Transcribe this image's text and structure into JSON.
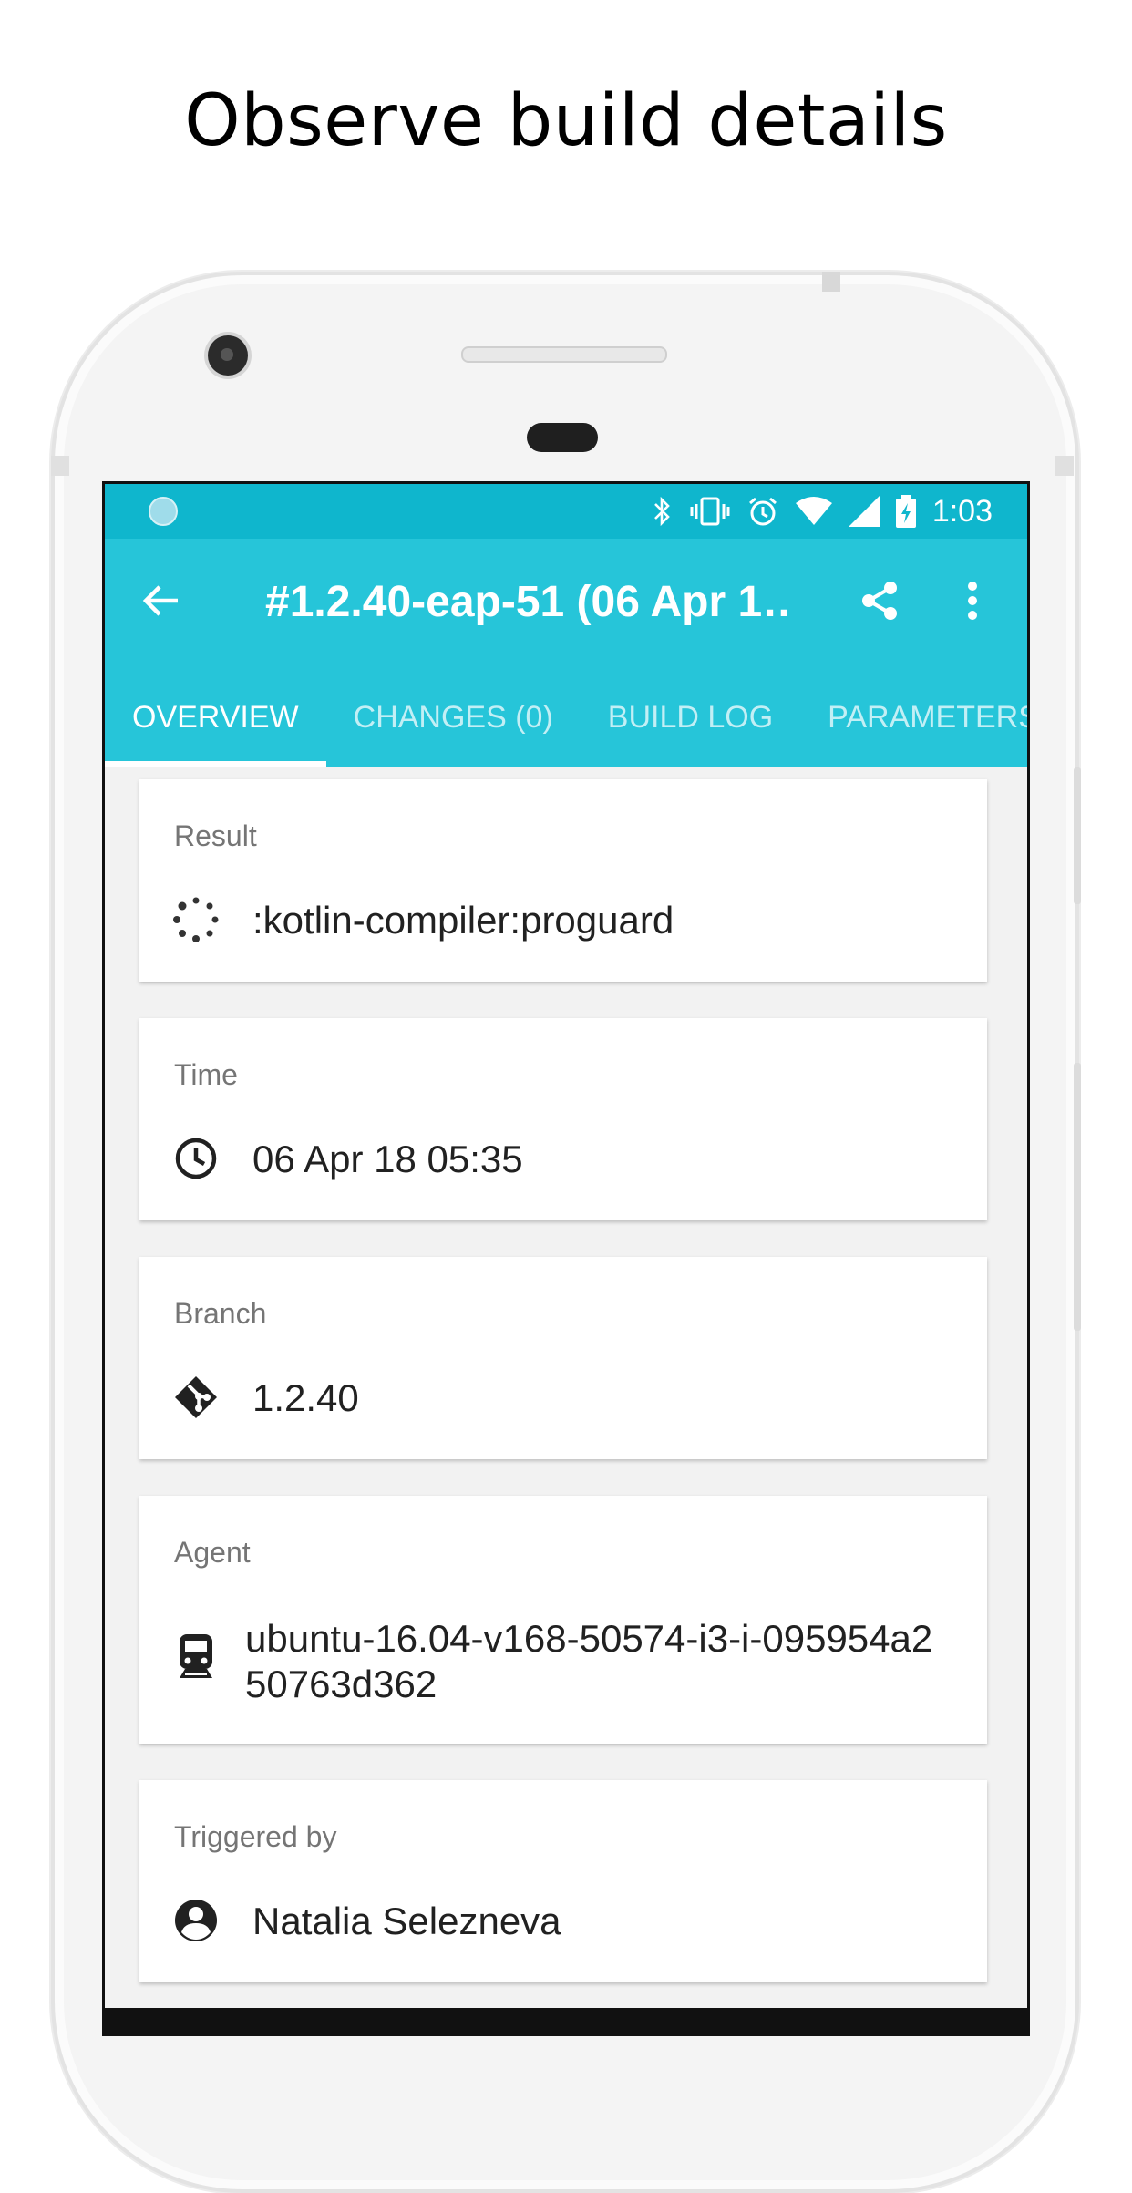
{
  "headline": "Observe build details",
  "status_bar": {
    "time": "1:03",
    "icons": [
      "notification-dot-icon",
      "bluetooth-icon",
      "vibrate-icon",
      "alarm-icon",
      "wifi-icon",
      "cell-signal-icon",
      "battery-charging-icon"
    ]
  },
  "app_bar": {
    "title": "#1.2.40-eap-51 (06 Apr 1…",
    "back_icon": "arrow-back-icon",
    "share_icon": "share-icon",
    "more_icon": "more-vert-icon"
  },
  "tabs": [
    {
      "label": "OVERVIEW",
      "active": true
    },
    {
      "label": "CHANGES (0)",
      "active": false
    },
    {
      "label": "BUILD LOG",
      "active": false
    },
    {
      "label": "PARAMETERS",
      "active": false
    }
  ],
  "cards": [
    {
      "label": "Result",
      "value": ":kotlin-compiler:proguard",
      "icon": "loading-spinner-icon"
    },
    {
      "label": "Time",
      "value": "06 Apr 18 05:35",
      "icon": "clock-icon"
    },
    {
      "label": "Branch",
      "value": "1.2.40",
      "icon": "git-branch-icon"
    },
    {
      "label": "Agent",
      "value_line1": "ubuntu-16.04-v168-50574-i3-i-095954a2",
      "value_line2": "50763d362",
      "icon": "train-icon"
    },
    {
      "label": "Triggered by",
      "value": "Natalia Selezneva",
      "icon": "account-circle-icon"
    }
  ],
  "colors": {
    "status_bar": "#0fb6cd",
    "app_bar": "#26c5d9",
    "background": "#f2f2f2"
  }
}
